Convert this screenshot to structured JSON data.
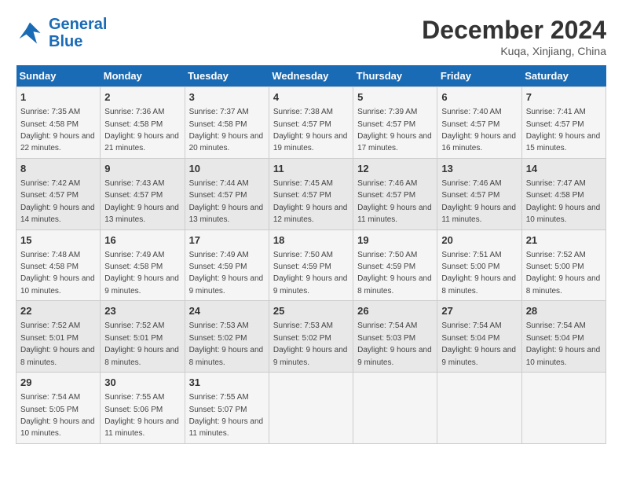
{
  "logo": {
    "general": "General",
    "blue": "Blue"
  },
  "header": {
    "month": "December 2024",
    "location": "Kuqa, Xinjiang, China"
  },
  "weekdays": [
    "Sunday",
    "Monday",
    "Tuesday",
    "Wednesday",
    "Thursday",
    "Friday",
    "Saturday"
  ],
  "weeks": [
    [
      {
        "day": 1,
        "sunrise": "7:35 AM",
        "sunset": "4:58 PM",
        "daylight": "9 hours and 22 minutes."
      },
      {
        "day": 2,
        "sunrise": "7:36 AM",
        "sunset": "4:58 PM",
        "daylight": "9 hours and 21 minutes."
      },
      {
        "day": 3,
        "sunrise": "7:37 AM",
        "sunset": "4:58 PM",
        "daylight": "9 hours and 20 minutes."
      },
      {
        "day": 4,
        "sunrise": "7:38 AM",
        "sunset": "4:57 PM",
        "daylight": "9 hours and 19 minutes."
      },
      {
        "day": 5,
        "sunrise": "7:39 AM",
        "sunset": "4:57 PM",
        "daylight": "9 hours and 17 minutes."
      },
      {
        "day": 6,
        "sunrise": "7:40 AM",
        "sunset": "4:57 PM",
        "daylight": "9 hours and 16 minutes."
      },
      {
        "day": 7,
        "sunrise": "7:41 AM",
        "sunset": "4:57 PM",
        "daylight": "9 hours and 15 minutes."
      }
    ],
    [
      {
        "day": 8,
        "sunrise": "7:42 AM",
        "sunset": "4:57 PM",
        "daylight": "9 hours and 14 minutes."
      },
      {
        "day": 9,
        "sunrise": "7:43 AM",
        "sunset": "4:57 PM",
        "daylight": "9 hours and 13 minutes."
      },
      {
        "day": 10,
        "sunrise": "7:44 AM",
        "sunset": "4:57 PM",
        "daylight": "9 hours and 13 minutes."
      },
      {
        "day": 11,
        "sunrise": "7:45 AM",
        "sunset": "4:57 PM",
        "daylight": "9 hours and 12 minutes."
      },
      {
        "day": 12,
        "sunrise": "7:46 AM",
        "sunset": "4:57 PM",
        "daylight": "9 hours and 11 minutes."
      },
      {
        "day": 13,
        "sunrise": "7:46 AM",
        "sunset": "4:57 PM",
        "daylight": "9 hours and 11 minutes."
      },
      {
        "day": 14,
        "sunrise": "7:47 AM",
        "sunset": "4:58 PM",
        "daylight": "9 hours and 10 minutes."
      }
    ],
    [
      {
        "day": 15,
        "sunrise": "7:48 AM",
        "sunset": "4:58 PM",
        "daylight": "9 hours and 10 minutes."
      },
      {
        "day": 16,
        "sunrise": "7:49 AM",
        "sunset": "4:58 PM",
        "daylight": "9 hours and 9 minutes."
      },
      {
        "day": 17,
        "sunrise": "7:49 AM",
        "sunset": "4:59 PM",
        "daylight": "9 hours and 9 minutes."
      },
      {
        "day": 18,
        "sunrise": "7:50 AM",
        "sunset": "4:59 PM",
        "daylight": "9 hours and 9 minutes."
      },
      {
        "day": 19,
        "sunrise": "7:50 AM",
        "sunset": "4:59 PM",
        "daylight": "9 hours and 8 minutes."
      },
      {
        "day": 20,
        "sunrise": "7:51 AM",
        "sunset": "5:00 PM",
        "daylight": "9 hours and 8 minutes."
      },
      {
        "day": 21,
        "sunrise": "7:52 AM",
        "sunset": "5:00 PM",
        "daylight": "9 hours and 8 minutes."
      }
    ],
    [
      {
        "day": 22,
        "sunrise": "7:52 AM",
        "sunset": "5:01 PM",
        "daylight": "9 hours and 8 minutes."
      },
      {
        "day": 23,
        "sunrise": "7:52 AM",
        "sunset": "5:01 PM",
        "daylight": "9 hours and 8 minutes."
      },
      {
        "day": 24,
        "sunrise": "7:53 AM",
        "sunset": "5:02 PM",
        "daylight": "9 hours and 8 minutes."
      },
      {
        "day": 25,
        "sunrise": "7:53 AM",
        "sunset": "5:02 PM",
        "daylight": "9 hours and 9 minutes."
      },
      {
        "day": 26,
        "sunrise": "7:54 AM",
        "sunset": "5:03 PM",
        "daylight": "9 hours and 9 minutes."
      },
      {
        "day": 27,
        "sunrise": "7:54 AM",
        "sunset": "5:04 PM",
        "daylight": "9 hours and 9 minutes."
      },
      {
        "day": 28,
        "sunrise": "7:54 AM",
        "sunset": "5:04 PM",
        "daylight": "9 hours and 10 minutes."
      }
    ],
    [
      {
        "day": 29,
        "sunrise": "7:54 AM",
        "sunset": "5:05 PM",
        "daylight": "9 hours and 10 minutes."
      },
      {
        "day": 30,
        "sunrise": "7:55 AM",
        "sunset": "5:06 PM",
        "daylight": "9 hours and 11 minutes."
      },
      {
        "day": 31,
        "sunrise": "7:55 AM",
        "sunset": "5:07 PM",
        "daylight": "9 hours and 11 minutes."
      },
      null,
      null,
      null,
      null
    ]
  ]
}
